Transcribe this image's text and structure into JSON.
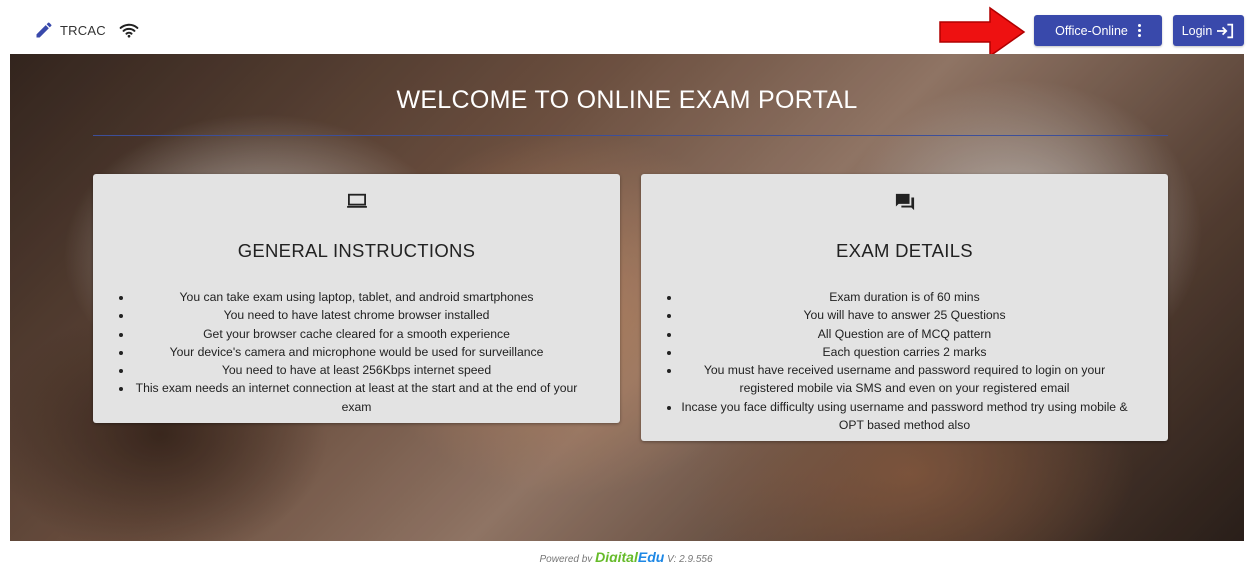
{
  "header": {
    "brand": "TRCAC",
    "office_button": "Office-Online",
    "login_button": "Login"
  },
  "hero": {
    "title": "WELCOME TO ONLINE EXAM PORTAL"
  },
  "general_card": {
    "title": "GENERAL INSTRUCTIONS",
    "items": [
      "You can take exam using laptop, tablet, and android smartphones",
      "You need to have latest chrome browser installed",
      "Get your browser cache cleared for a smooth experience",
      "Your device's camera and microphone would be used for surveillance",
      "You need to have at least 256Kbps internet speed",
      "This exam needs an internet connection at least at the start and at the end of your exam"
    ]
  },
  "exam_card": {
    "title": "EXAM DETAILS",
    "items": [
      "Exam duration is of 60 mins",
      "You will have to answer 25 Questions",
      "All Question are of MCQ pattern",
      "Each question carries 2 marks",
      "You must have received username and password required to login on your registered mobile via SMS and even on your registered email",
      "Incase you face difficulty using username and password method try using mobile & OPT based method also"
    ]
  },
  "footer": {
    "powered_by": "Powered by",
    "brand_part1": "Digital",
    "brand_part2": "Edu",
    "version": "V: 2.9.556"
  },
  "colors": {
    "primary": "#3949ab",
    "card_bg": "#e3e3e3",
    "divider": "#3d4f99",
    "arrow": "#ee1111"
  }
}
